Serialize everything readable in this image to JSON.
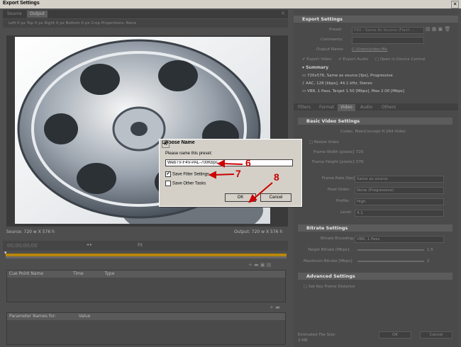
{
  "window": {
    "title": "Export Settings"
  },
  "left": {
    "tabs": [
      "Source",
      "Output"
    ],
    "cropbar": "Left  0 px  Top  0 px  Right  0 px  Bottom  0 px   Crop Proportions:  None",
    "source_text": "Source: 720 w X 576 h",
    "output_text": "Output: 720 w X 576 h",
    "timecode": "00;00;00;00",
    "fit": "Fit",
    "cue_headers": [
      "Cue Point Name",
      "Time",
      "Type"
    ],
    "param_headers": [
      "Parameter Names for:",
      "Value"
    ]
  },
  "export_settings": {
    "title": "Export Settings",
    "preset_label": "Preset:",
    "preset_value": "F4V - Same As Source (Flash ...",
    "comments_label": "Comments:",
    "comments_value": "",
    "output_name_label": "Output Name:",
    "output_name_value": "C:\\Users\\video.f4v",
    "export_video": "Export Video",
    "export_audio": "Export Audio",
    "open_device": "Open in Device Central",
    "summary_title": "Summary",
    "summary": [
      "720x576, Same as source [fps], Progressive",
      "AAC, 128 [kbps], 44.1 kHz, Stereo",
      "VBR, 1 Pass, Target 1.50 [Mbps], Max 2.00 [Mbps]"
    ]
  },
  "tabs": [
    "Filters",
    "Format",
    "Video",
    "Audio",
    "Others"
  ],
  "video": {
    "basic_title": "Basic Video Settings",
    "codec": "Codec:  MainConcept H.264 Video",
    "resize_label": "Resize Video",
    "frame_width_label": "Frame Width [pixels]:",
    "frame_width": "720",
    "frame_height_label": "Frame Height [pixels]:",
    "frame_height": "576",
    "frame_rate_label": "Frame Rate [fps]:",
    "frame_rate": "Same as source",
    "field_order_label": "Field Order:",
    "field_order": "None (Progressive)",
    "profile_label": "Profile:",
    "profile": "High",
    "level_label": "Level:",
    "level": "4.1",
    "bitrate_title": "Bitrate Settings",
    "encoding_label": "Bitrate Encoding:",
    "encoding": "VBR, 1 Pass",
    "target_label": "Target Bitrate [Mbps]:",
    "target": "1.5",
    "max_label": "Maximum Bitrate [Mbps]:",
    "max": "2",
    "advanced_title": "Advanced Settings",
    "keyframe": "Set Key Frame Distance",
    "estimated": "Estimated File Size:",
    "estimated_value": "3 MB",
    "ok": "OK",
    "cancel": "Cancel"
  },
  "dialog": {
    "title": "Choose Name",
    "prompt": "Please name this preset:",
    "value": "WebTV-F4V-PAL-700Kbps",
    "save_filter": "Save Filter Settings",
    "save_filter_checked": "✔",
    "save_other": "Save Other Tasks",
    "ok": "OK",
    "cancel": "Cancel"
  },
  "callouts": [
    "6",
    "7",
    "8"
  ]
}
